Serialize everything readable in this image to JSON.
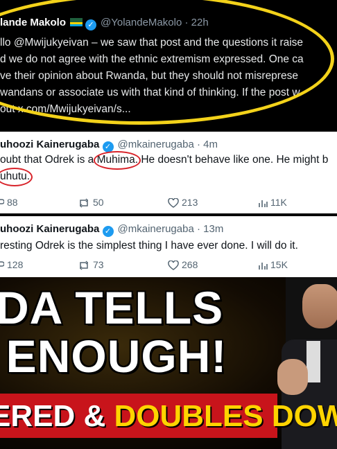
{
  "tweet1": {
    "name": "lande Makolo",
    "handle": "@YolandeMakolo",
    "time": "22h",
    "lines": [
      "llo @Mwijukyeivan – we saw that post and the questions it raise",
      "d we do not agree with the ethnic extremism expressed. One ca",
      "ve their opinion about Rwanda, but they should not misreprese",
      "wandans or associate us with that kind of thinking. If the post w",
      "out x.com/Mwijukyeivan/s..."
    ],
    "separator": "·",
    "badge_glyph": "✓"
  },
  "tweet2": {
    "name": "uhoozi Kainerugaba",
    "handle": "@mkainerugaba",
    "time": "4m",
    "line1_a": "oubt that Odrek is a ",
    "line1_circled": "Muhima.",
    "line1_b": " He doesn't behave like one. He might b",
    "line2_circled": "uhutu.",
    "stats": {
      "replies": "88",
      "reposts": "50",
      "likes": "213",
      "views": "11K"
    }
  },
  "tweet3": {
    "name": "uhoozi Kainerugaba",
    "handle": "@mkainerugaba",
    "time": "13m",
    "line1": "resting Odrek is the simplest thing I have ever done. I will do it.",
    "stats": {
      "replies": "128",
      "reposts": "73",
      "likes": "268",
      "views": "15K"
    }
  },
  "banner": {
    "line1": "DA TELLS",
    "line2": "I ENOUGH!",
    "line3_white": "ERED & ",
    "line3_yellow": "DOUBLES DOWN"
  },
  "colors": {
    "highlight": "#f3d21a",
    "circle": "#d8232a",
    "accent": "#c8141b",
    "link": "#1d9bf0"
  }
}
